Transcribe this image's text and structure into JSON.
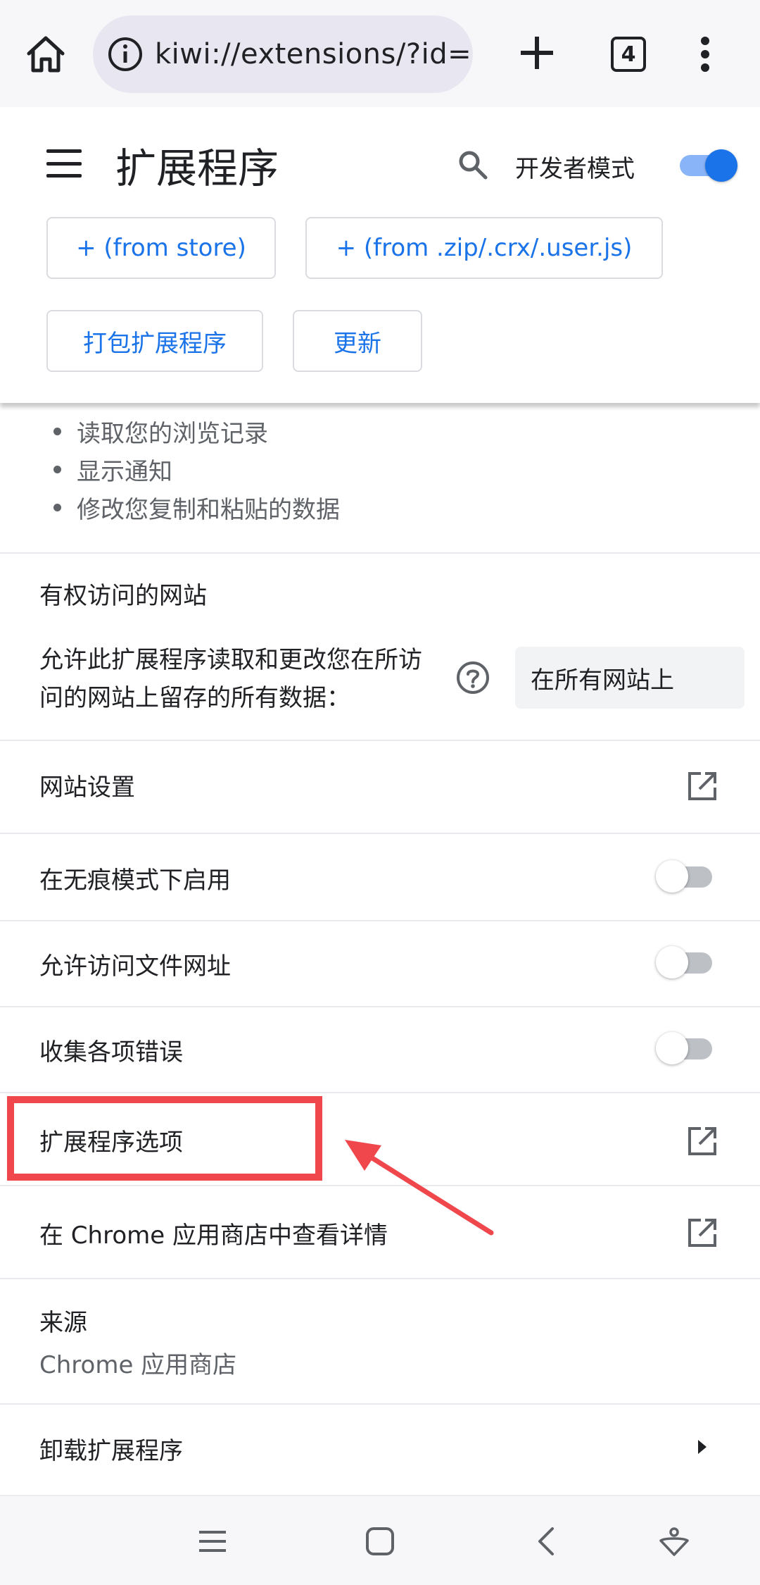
{
  "browser": {
    "url": "kiwi://extensions/?id=",
    "tab_count": "4"
  },
  "header": {
    "title": "扩展程序",
    "developer_mode_label": "开发者模式",
    "developer_mode_on": true,
    "buttons": {
      "from_store": "+ (from store)",
      "from_zip": "+ (from .zip/.crx/.user.js)",
      "pack": "打包扩展程序",
      "update": "更新"
    }
  },
  "permissions": [
    "读取您的浏览记录",
    "显示通知",
    "修改您复制和粘贴的数据"
  ],
  "site_access": {
    "title": "有权访问的网站",
    "description": "允许此扩展程序读取和更改您在所访问的网站上留存的所有数据：",
    "selected": "在所有网站上"
  },
  "settings": {
    "site_settings": "网站设置",
    "incognito": {
      "label": "在无痕模式下启用",
      "enabled": false
    },
    "file_urls": {
      "label": "允许访问文件网址",
      "enabled": false
    },
    "collect_errors": {
      "label": "收集各项错误",
      "enabled": false
    },
    "extension_options": "扩展程序选项",
    "view_in_store": "在 Chrome 应用商店中查看详情"
  },
  "source": {
    "label": "来源",
    "value": "Chrome 应用商店"
  },
  "uninstall": "卸载扩展程序",
  "colors": {
    "accent": "#1a73e8",
    "annotation": "#f0474d",
    "toggle_off_track": "#bdc1c6"
  },
  "icons": {
    "home": "home-icon",
    "info": "info-icon",
    "new_tab": "plus-icon",
    "menu": "more-vert-icon",
    "search": "search-icon",
    "help": "help-icon",
    "open_in_new": "open-in-new-icon",
    "arrow_right": "arrow-right-icon"
  }
}
